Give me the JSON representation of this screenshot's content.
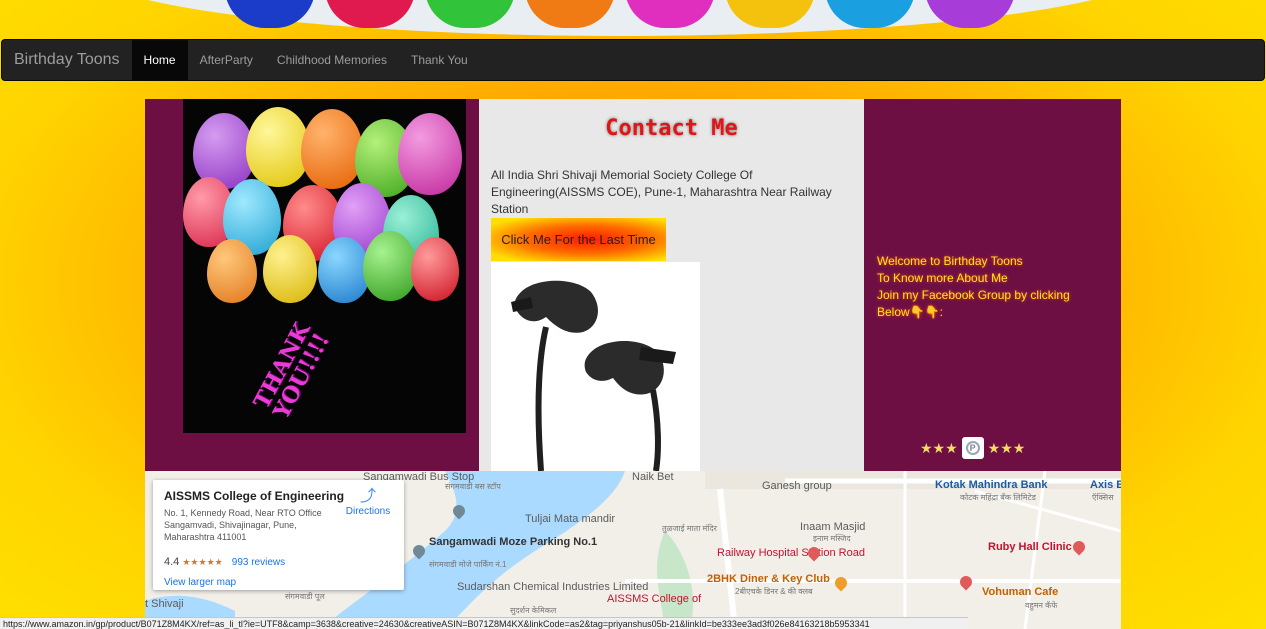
{
  "navbar": {
    "brand": "Birthday Toons",
    "links": [
      {
        "label": "Home",
        "active": true
      },
      {
        "label": "AfterParty",
        "active": false
      },
      {
        "label": "Childhood Memories",
        "active": false
      },
      {
        "label": "Thank You",
        "active": false
      }
    ]
  },
  "left_panel": {
    "image_text_line1": "THANK",
    "image_text_line2": "YOU!!!!"
  },
  "contact": {
    "title": "Contact Me",
    "address": "All India Shri Shivaji Memorial Society College Of Engineering(AISSMS COE), Pune-1, Maharashtra Near Railway Station",
    "button_label": "Click Me For the Last Time",
    "ad_icon": "earphones-product-image"
  },
  "right_panel": {
    "line1": "Welcome to Birthday Toons",
    "line2": "To Know more About Me",
    "line3": "Join my Facebook Group by clicking",
    "line4": "Below👇👇:",
    "stars_left": "★★★",
    "stars_right": "★★★",
    "share_icon": "pinterest-icon"
  },
  "map": {
    "card": {
      "name": "AISSMS College of Engineering",
      "address": "No. 1, Kennedy Road, Near RTO Office Sangamvadi, Shivajinagar, Pune, Maharashtra 411001",
      "rating": "4.4",
      "stars": "★★★★★",
      "reviews": "993 reviews",
      "directions": "Directions",
      "view_larger": "View larger map"
    },
    "labels": {
      "bus_stop": "Sangamwadi Bus Stop",
      "bus_stop_local": "संगमवाडी बस स्टॉप",
      "naik_bet": "Naik Bet",
      "ganesh_group": "Ganesh group",
      "kotak": "Kotak Mahindra Bank",
      "kotak_local": "कोटक महिंद्रा बँक लिमिटेड",
      "axis": "Axis Ba",
      "axis_local": "ऍक्सिस",
      "tuljai": "Tuljai Mata mandir",
      "tuljai_local": "तुळजाई माता मंदिर",
      "inaam": "Inaam Masjid",
      "inaam_local": "इनाम मस्जिद",
      "sangamwadi_moze": "Sangamwadi Moze Parking No.1",
      "sangamwadi_moze_local": "संगमवाडी मोजे पार्किंग नं.1",
      "railway_hospital": "Railway Hospital Station Road",
      "ruby_hall": "Ruby Hall Clinic",
      "bhk_diner": "2BHK Diner & Key Club",
      "bhk_diner_local": "2बीएचके डिनर & की क्लब",
      "sudarshan": "Sudarshan Chemical Industries Limited",
      "sudarshan_local": "सुदर्शन केमिकल",
      "aissms": "AISSMS College of",
      "vohuman": "Vohuman Cafe",
      "vohuman_local": "वहुमन कॅफे",
      "shivaji": "t Shivaji",
      "sangamwadi_bridge_local": "संगमवाडी पूल"
    }
  },
  "status_bar": "https://www.amazon.in/gp/product/B071Z8M4KX/ref=as_li_tl?ie=UTF8&camp=3638&creative=24630&creativeASIN=B071Z8M4KX&linkCode=as2&tag=priyanshus05b-21&linkId=be333ee3ad3f026e84163218b5953341"
}
